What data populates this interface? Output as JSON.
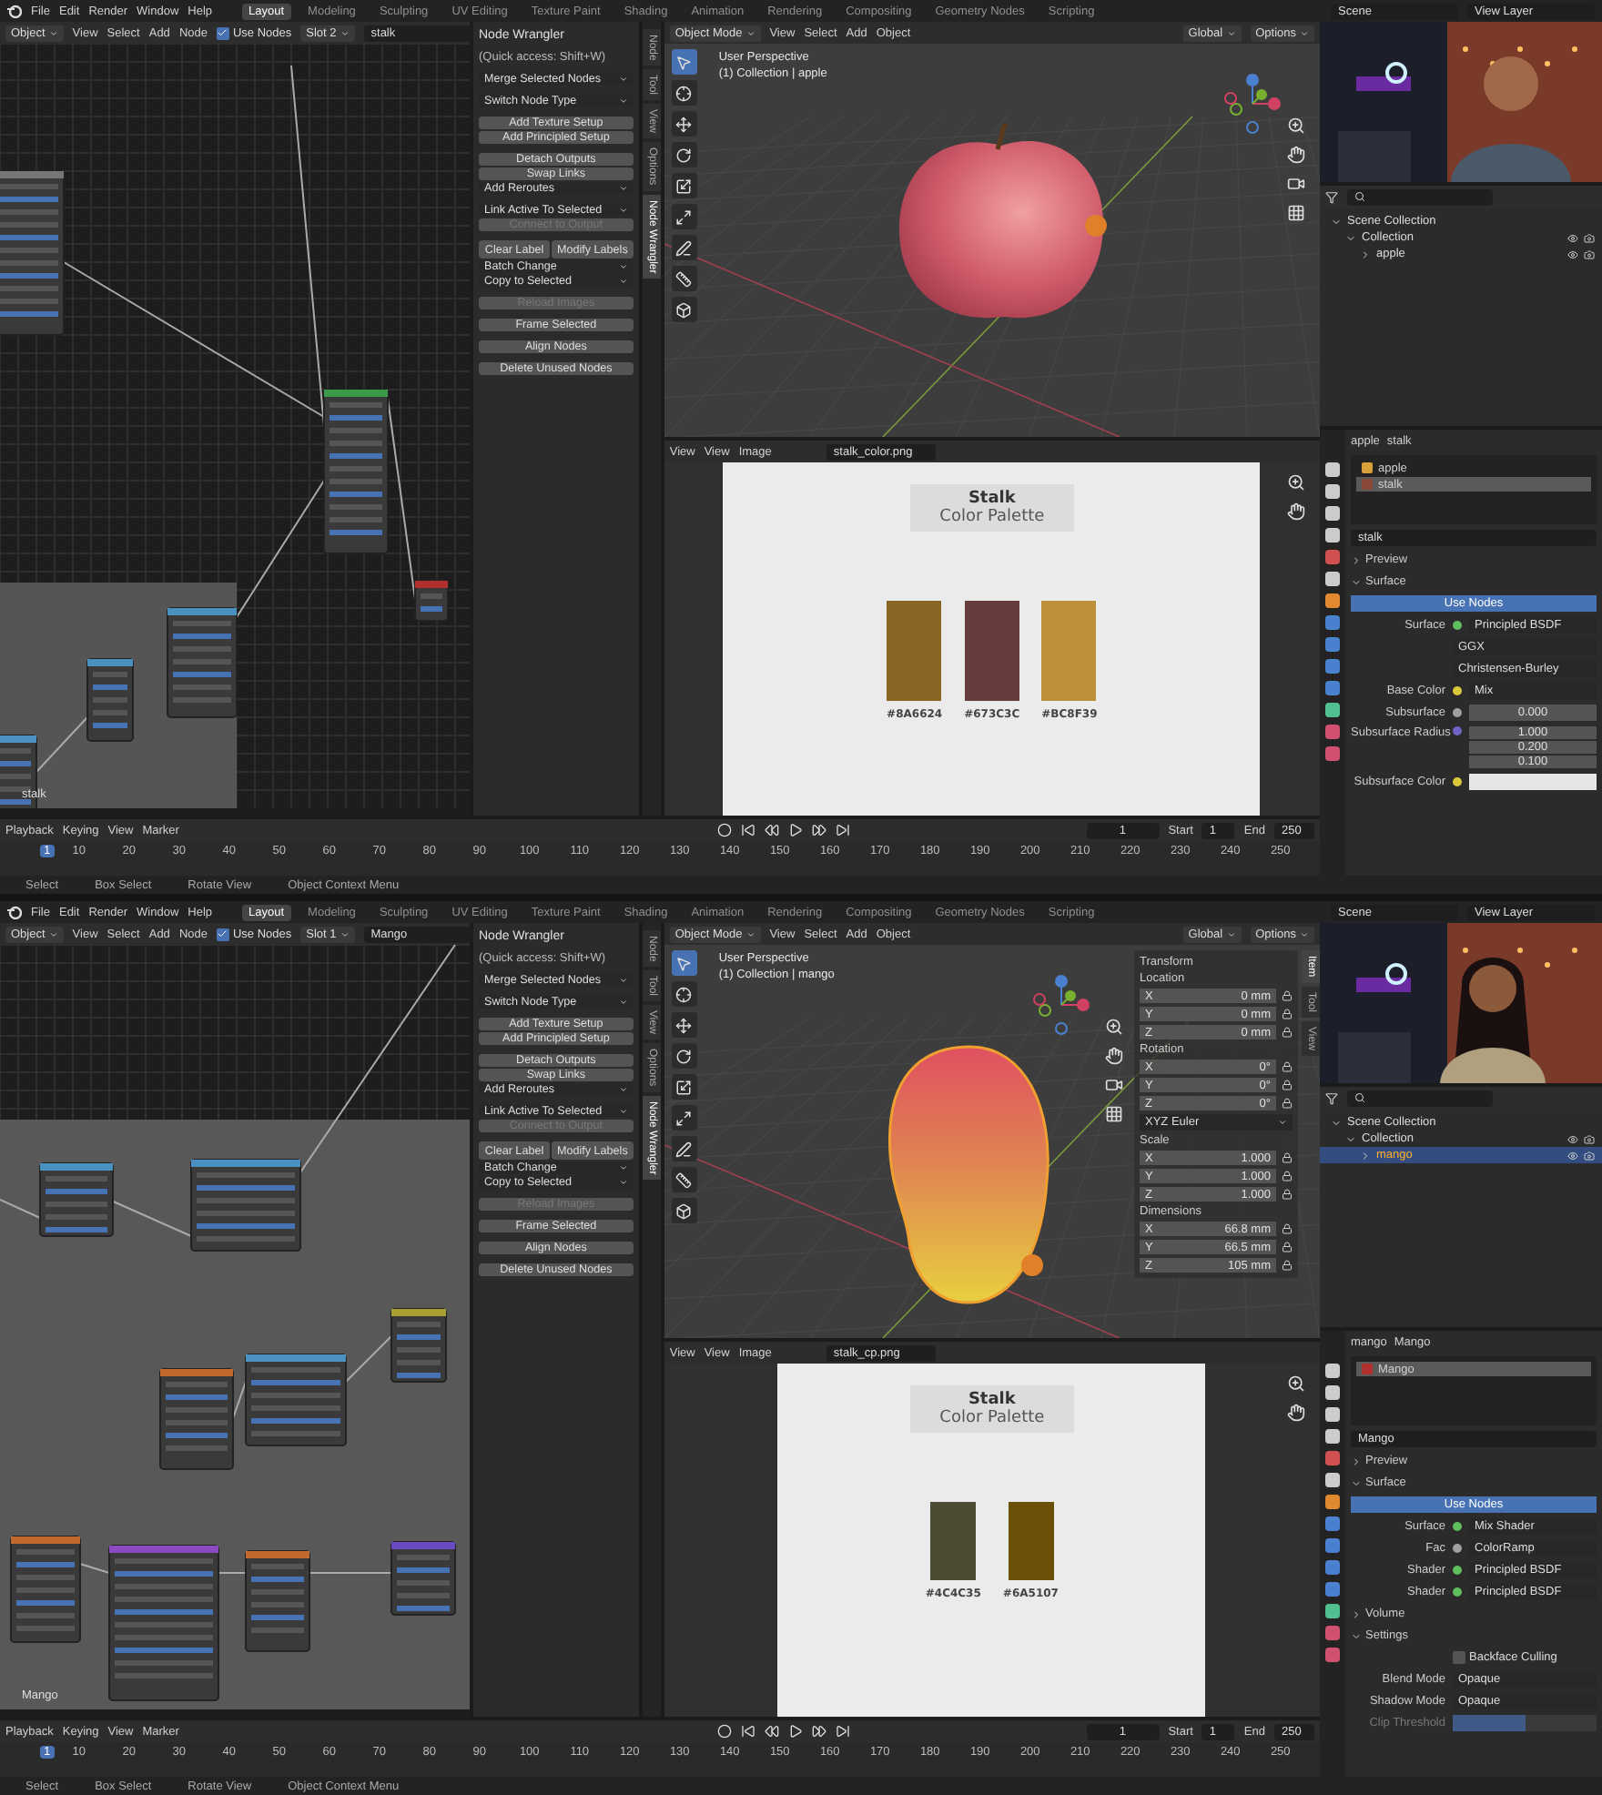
{
  "screens": [
    {
      "menu": [
        "File",
        "Edit",
        "Render",
        "Window",
        "Help"
      ],
      "workspaces": [
        {
          "label": "Layout",
          "selected": true
        },
        {
          "label": "Modeling",
          "selected": false
        },
        {
          "label": "Sculpting",
          "selected": false
        },
        {
          "label": "UV Editing",
          "selected": false
        },
        {
          "label": "Texture Paint",
          "selected": false
        },
        {
          "label": "Shading",
          "selected": false
        },
        {
          "label": "Animation",
          "selected": false
        },
        {
          "label": "Rendering",
          "selected": false
        },
        {
          "label": "Compositing",
          "selected": false
        },
        {
          "label": "Geometry Nodes",
          "selected": false
        },
        {
          "label": "Scripting",
          "selected": false
        }
      ],
      "scene": "Scene",
      "view_layer": "View Layer",
      "node_editor": {
        "mode": "Object",
        "menus": [
          "View",
          "Select",
          "Add",
          "Node"
        ],
        "use_nodes": {
          "label": "Use Nodes",
          "checked": true
        },
        "slot": "Slot 2",
        "material": "stalk",
        "frame_label": "stalk"
      },
      "node_wrangler": {
        "title": "Node Wrangler",
        "hint": "(Quick access: Shift+W)",
        "groups": [
          [
            {
              "kind": "dropdown",
              "label": "Merge Selected Nodes",
              "disabled": false
            }
          ],
          [
            {
              "kind": "dropdown",
              "label": "Switch Node Type",
              "disabled": false
            }
          ],
          [
            {
              "kind": "button",
              "label": "Add Texture Setup",
              "disabled": false
            },
            {
              "kind": "button",
              "label": "Add Principled Setup",
              "disabled": false
            }
          ],
          [
            {
              "kind": "button",
              "label": "Detach Outputs",
              "disabled": false
            },
            {
              "kind": "button",
              "label": "Swap Links",
              "disabled": false
            },
            {
              "kind": "dropdown",
              "label": "Add Reroutes",
              "disabled": false
            }
          ],
          [
            {
              "kind": "dropdown",
              "label": "Link Active To Selected",
              "disabled": false
            },
            {
              "kind": "button",
              "label": "Connect to Output",
              "disabled": true
            }
          ],
          [
            {
              "kind": "pair",
              "labels": [
                "Clear Label",
                "Modify Labels"
              ],
              "disabled": false
            },
            {
              "kind": "dropdown",
              "label": "Batch Change",
              "disabled": false
            },
            {
              "kind": "dropdown",
              "label": "Copy to Selected",
              "disabled": false
            }
          ],
          [
            {
              "kind": "button",
              "label": "Reload Images",
              "disabled": true
            }
          ],
          [
            {
              "kind": "button",
              "label": "Frame Selected",
              "disabled": false
            }
          ],
          [
            {
              "kind": "button",
              "label": "Align Nodes",
              "disabled": false
            }
          ],
          [
            {
              "kind": "button",
              "label": "Delete Unused Nodes",
              "disabled": false
            }
          ]
        ]
      },
      "sidebar_tabs": [
        {
          "label": "Node",
          "selected": false
        },
        {
          "label": "Tool",
          "selected": false
        },
        {
          "label": "View",
          "selected": false
        },
        {
          "label": "Options",
          "selected": false
        },
        {
          "label": "Node Wrangler",
          "selected": true
        }
      ],
      "viewport": {
        "mode": "Object Mode",
        "menus": [
          "View",
          "Select",
          "Add",
          "Object"
        ],
        "orientation": "Global",
        "options": "Options",
        "perspective": "User Perspective",
        "collection": "(1) Collection | apple",
        "object": {
          "kind": "apple",
          "selected": false
        },
        "tools": [
          {
            "kind": "select",
            "selected": true
          },
          {
            "kind": "cursor",
            "selected": false
          },
          {
            "kind": "move",
            "selected": false
          },
          {
            "kind": "rotate",
            "selected": false
          },
          {
            "kind": "scale",
            "selected": false
          },
          {
            "kind": "transform",
            "selected": false
          },
          {
            "kind": "annotate",
            "selected": false
          },
          {
            "kind": "measure",
            "selected": false
          },
          {
            "kind": "add",
            "selected": false
          }
        ]
      },
      "image_editor": {
        "menus": [
          "View",
          "View",
          "Image"
        ],
        "filename": "stalk_color.png",
        "palette": {
          "title": "Stalk",
          "subtitle": "Color Palette",
          "swatches": [
            {
              "color": "#8a6624",
              "label": "#8A6624"
            },
            {
              "color": "#673c3c",
              "label": "#673C3C"
            },
            {
              "color": "#bc8f39",
              "label": "#BC8F39"
            }
          ]
        }
      },
      "outliner": {
        "items": [
          {
            "label": "Scene Collection",
            "selected": false,
            "children": [
              {
                "label": "Collection",
                "selected": false,
                "children": [
                  {
                    "label": "apple",
                    "selected": false
                  }
                ]
              }
            ]
          }
        ]
      },
      "properties": {
        "object": "apple",
        "material": "stalk",
        "slots": [
          {
            "label": "apple",
            "selected": false,
            "color": "#d9a03a"
          },
          {
            "label": "stalk",
            "selected": true,
            "color": "#8a4a3a"
          }
        ],
        "material_name": "stalk",
        "rows": [
          {
            "kind": "section",
            "label": "Preview",
            "expanded": false
          },
          {
            "kind": "section",
            "label": "Surface",
            "expanded": true
          },
          {
            "kind": "button",
            "label": "Use Nodes"
          },
          {
            "kind": "socket",
            "label": "Surface",
            "value": "Principled BSDF",
            "color": "#5fbf5f"
          },
          {
            "kind": "dropdown",
            "value": "GGX"
          },
          {
            "kind": "dropdown",
            "value": "Christensen-Burley"
          },
          {
            "kind": "socket",
            "label": "Base Color",
            "value": "Mix",
            "color": "#d8c83a"
          },
          {
            "kind": "number",
            "label": "Subsurface",
            "value": "0.000",
            "color": "#a0a0a0"
          },
          {
            "kind": "vector",
            "label": "Subsurface Radius",
            "values": [
              "1.000",
              "0.200",
              "0.100"
            ],
            "color": "#6f63c7"
          },
          {
            "kind": "color_field",
            "label": "Subsurface Color",
            "color": "#d8c83a"
          }
        ]
      },
      "timeline": {
        "menus": [
          "Playback",
          "Keying",
          "View",
          "Marker"
        ],
        "marker": "1",
        "ticks": [
          "10",
          "20",
          "30",
          "40",
          "50",
          "60",
          "70",
          "80",
          "90",
          "100",
          "110",
          "120",
          "130",
          "140",
          "150",
          "160",
          "170",
          "180",
          "190",
          "200",
          "210",
          "220",
          "230",
          "240",
          "250"
        ],
        "current": "1",
        "start_label": "Start",
        "start": "1",
        "end_label": "End",
        "end": "250"
      },
      "status": [
        "Select",
        "Box Select",
        "Rotate View",
        "Object Context Menu"
      ]
    },
    {
      "menu": [
        "File",
        "Edit",
        "Render",
        "Window",
        "Help"
      ],
      "workspaces": [
        {
          "label": "Layout",
          "selected": true
        },
        {
          "label": "Modeling",
          "selected": false
        },
        {
          "label": "Sculpting",
          "selected": false
        },
        {
          "label": "UV Editing",
          "selected": false
        },
        {
          "label": "Texture Paint",
          "selected": false
        },
        {
          "label": "Shading",
          "selected": false
        },
        {
          "label": "Animation",
          "selected": false
        },
        {
          "label": "Rendering",
          "selected": false
        },
        {
          "label": "Compositing",
          "selected": false
        },
        {
          "label": "Geometry Nodes",
          "selected": false
        },
        {
          "label": "Scripting",
          "selected": false
        }
      ],
      "scene": "Scene",
      "view_layer": "View Layer",
      "node_editor": {
        "mode": "Object",
        "menus": [
          "View",
          "Select",
          "Add",
          "Node"
        ],
        "use_nodes": {
          "label": "Use Nodes",
          "checked": true
        },
        "slot": "Slot 1",
        "material": "Mango",
        "frame_label": "Mango"
      },
      "node_wrangler": {
        "title": "Node Wrangler",
        "hint": "(Quick access: Shift+W)",
        "groups": [
          [
            {
              "kind": "dropdown",
              "label": "Merge Selected Nodes",
              "disabled": false
            }
          ],
          [
            {
              "kind": "dropdown",
              "label": "Switch Node Type",
              "disabled": false
            }
          ],
          [
            {
              "kind": "button",
              "label": "Add Texture Setup",
              "disabled": false
            },
            {
              "kind": "button",
              "label": "Add Principled Setup",
              "disabled": false
            }
          ],
          [
            {
              "kind": "button",
              "label": "Detach Outputs",
              "disabled": false
            },
            {
              "kind": "button",
              "label": "Swap Links",
              "disabled": false
            },
            {
              "kind": "dropdown",
              "label": "Add Reroutes",
              "disabled": false
            }
          ],
          [
            {
              "kind": "dropdown",
              "label": "Link Active To Selected",
              "disabled": false
            },
            {
              "kind": "button",
              "label": "Connect to Output",
              "disabled": true
            }
          ],
          [
            {
              "kind": "pair",
              "labels": [
                "Clear Label",
                "Modify Labels"
              ],
              "disabled": false
            },
            {
              "kind": "dropdown",
              "label": "Batch Change",
              "disabled": false
            },
            {
              "kind": "dropdown",
              "label": "Copy to Selected",
              "disabled": false
            }
          ],
          [
            {
              "kind": "button",
              "label": "Reload Images",
              "disabled": true
            }
          ],
          [
            {
              "kind": "button",
              "label": "Frame Selected",
              "disabled": false
            }
          ],
          [
            {
              "kind": "button",
              "label": "Align Nodes",
              "disabled": false
            }
          ],
          [
            {
              "kind": "button",
              "label": "Delete Unused Nodes",
              "disabled": false
            }
          ]
        ]
      },
      "sidebar_tabs": [
        {
          "label": "Node",
          "selected": false
        },
        {
          "label": "Tool",
          "selected": false
        },
        {
          "label": "View",
          "selected": false
        },
        {
          "label": "Options",
          "selected": false
        },
        {
          "label": "Node Wrangler",
          "selected": true
        }
      ],
      "viewport": {
        "mode": "Object Mode",
        "menus": [
          "View",
          "Select",
          "Add",
          "Object"
        ],
        "orientation": "Global",
        "options": "Options",
        "perspective": "User Perspective",
        "collection": "(1) Collection | mango",
        "object": {
          "kind": "mango",
          "selected": true
        },
        "tools": [
          {
            "kind": "select",
            "selected": true
          },
          {
            "kind": "cursor",
            "selected": false
          },
          {
            "kind": "move",
            "selected": false
          },
          {
            "kind": "rotate",
            "selected": false
          },
          {
            "kind": "scale",
            "selected": false
          },
          {
            "kind": "transform",
            "selected": false
          },
          {
            "kind": "annotate",
            "selected": false
          },
          {
            "kind": "measure",
            "selected": false
          },
          {
            "kind": "add",
            "selected": false
          }
        ],
        "transform": {
          "title": "Transform",
          "tabs": [
            {
              "label": "Item",
              "selected": true
            },
            {
              "label": "Tool",
              "selected": false
            },
            {
              "label": "View",
              "selected": false
            }
          ],
          "rows": [
            {
              "kind": "group",
              "label": "Location",
              "fields": [
                {
                  "axis": "X",
                  "value": "0 mm"
                },
                {
                  "axis": "Y",
                  "value": "0 mm"
                },
                {
                  "axis": "Z",
                  "value": "0 mm"
                }
              ]
            },
            {
              "kind": "group",
              "label": "Rotation",
              "fields": [
                {
                  "axis": "X",
                  "value": "0°"
                },
                {
                  "axis": "Y",
                  "value": "0°"
                },
                {
                  "axis": "Z",
                  "value": "0°"
                }
              ]
            },
            {
              "kind": "select",
              "value": "XYZ Euler"
            },
            {
              "kind": "group",
              "label": "Scale",
              "fields": [
                {
                  "axis": "X",
                  "value": "1.000"
                },
                {
                  "axis": "Y",
                  "value": "1.000"
                },
                {
                  "axis": "Z",
                  "value": "1.000"
                }
              ]
            },
            {
              "kind": "group",
              "label": "Dimensions",
              "fields": [
                {
                  "axis": "X",
                  "value": "66.8 mm"
                },
                {
                  "axis": "Y",
                  "value": "66.5 mm"
                },
                {
                  "axis": "Z",
                  "value": "105 mm"
                }
              ]
            }
          ]
        }
      },
      "image_editor": {
        "menus": [
          "View",
          "View",
          "Image"
        ],
        "filename": "stalk_cp.png",
        "palette": {
          "title": "Stalk",
          "subtitle": "Color Palette",
          "swatches": [
            {
              "color": "#4c4c35",
              "label": "#4C4C35"
            },
            {
              "color": "#6a5107",
              "label": "#6A5107"
            }
          ]
        }
      },
      "outliner": {
        "items": [
          {
            "label": "Scene Collection",
            "selected": false,
            "children": [
              {
                "label": "Collection",
                "selected": false,
                "children": [
                  {
                    "label": "mango",
                    "selected": true
                  }
                ]
              }
            ]
          }
        ]
      },
      "properties": {
        "object": "mango",
        "material": "Mango",
        "slots": [
          {
            "label": "Mango",
            "selected": true,
            "color": "#b03030"
          }
        ],
        "material_name": "Mango",
        "rows": [
          {
            "kind": "section",
            "label": "Preview",
            "expanded": false
          },
          {
            "kind": "section",
            "label": "Surface",
            "expanded": true
          },
          {
            "kind": "button",
            "label": "Use Nodes"
          },
          {
            "kind": "socket",
            "label": "Surface",
            "value": "Mix Shader",
            "color": "#5fbf5f"
          },
          {
            "kind": "socket",
            "label": "Fac",
            "value": "ColorRamp",
            "color": "#a0a0a0"
          },
          {
            "kind": "socket",
            "label": "Shader",
            "value": "Principled BSDF",
            "color": "#5fbf5f"
          },
          {
            "kind": "socket",
            "label": "Shader",
            "value": "Principled BSDF",
            "color": "#5fbf5f"
          },
          {
            "kind": "section",
            "label": "Volume",
            "expanded": false
          },
          {
            "kind": "section",
            "label": "Settings",
            "expanded": true
          },
          {
            "kind": "checkbox",
            "label": "Backface Culling",
            "checked": false
          },
          {
            "kind": "select",
            "label": "Blend Mode",
            "value": "Opaque"
          },
          {
            "kind": "select",
            "label": "Shadow Mode",
            "value": "Opaque"
          },
          {
            "kind": "slider",
            "label": "Clip Threshold",
            "level": 0.5,
            "disabled": true
          }
        ]
      },
      "timeline": {
        "menus": [
          "Playback",
          "Keying",
          "View",
          "Marker"
        ],
        "marker": "1",
        "ticks": [
          "10",
          "20",
          "30",
          "40",
          "50",
          "60",
          "70",
          "80",
          "90",
          "100",
          "110",
          "120",
          "130",
          "140",
          "150",
          "160",
          "170",
          "180",
          "190",
          "200",
          "210",
          "220",
          "230",
          "240",
          "250"
        ],
        "current": "1",
        "start_label": "Start",
        "start": "1",
        "end_label": "End",
        "end": "250"
      },
      "status": [
        "Select",
        "Box Select",
        "Rotate View",
        "Object Context Menu"
      ]
    }
  ]
}
